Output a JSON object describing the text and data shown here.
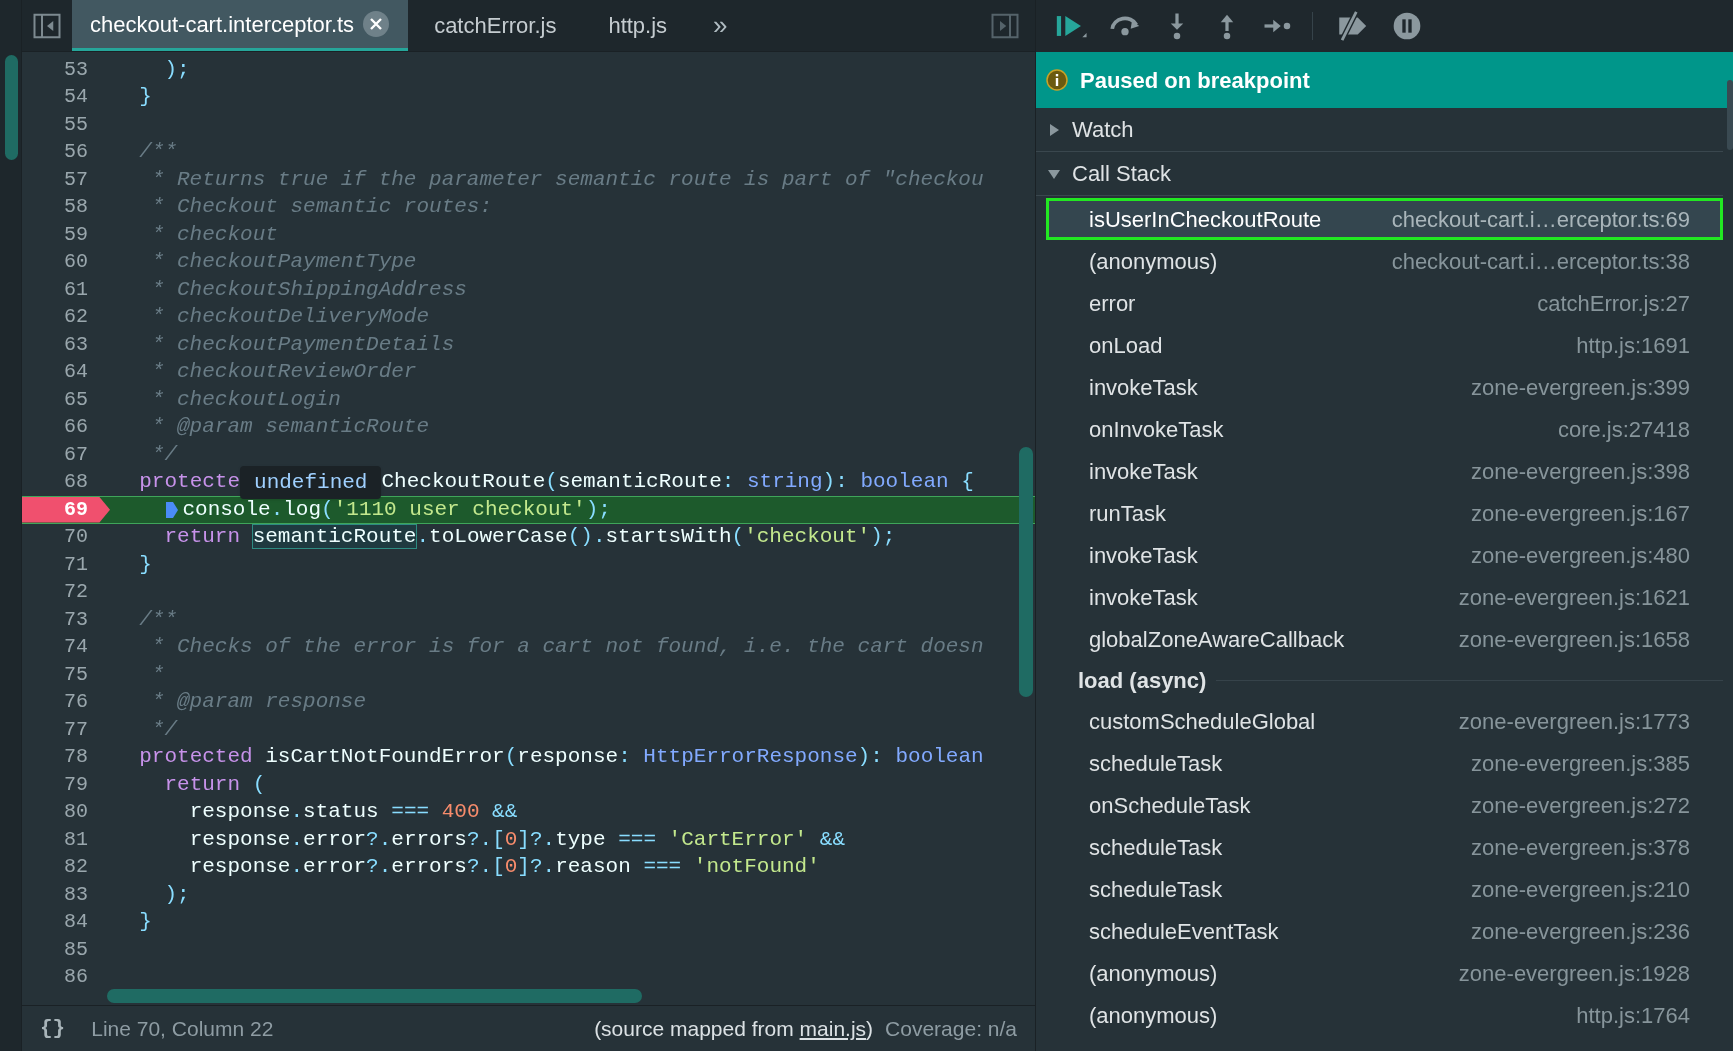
{
  "editor": {
    "tabs": [
      {
        "label": "checkout-cart.interceptor.ts",
        "selected": true,
        "closable": true
      },
      {
        "label": "catchError.js",
        "selected": false,
        "closable": false
      },
      {
        "label": "http.js",
        "selected": false,
        "closable": false
      }
    ],
    "tab_overflow": "»",
    "lines": [
      {
        "number": "53",
        "breakpoint": false,
        "current": false,
        "tokens": [
          {
            "kind": "punct",
            "text": "    );"
          }
        ]
      },
      {
        "number": "54",
        "breakpoint": false,
        "current": false,
        "tokens": [
          {
            "kind": "punct",
            "text": "  }"
          }
        ]
      },
      {
        "number": "55",
        "breakpoint": false,
        "current": false
      },
      {
        "number": "56",
        "breakpoint": false,
        "current": false,
        "tokens": [
          {
            "kind": "comment",
            "text": "  /**"
          }
        ]
      },
      {
        "number": "57",
        "breakpoint": false,
        "current": false,
        "tokens": [
          {
            "kind": "comment",
            "text": "   * Returns true if the parameter semantic route is part of \"checkou"
          }
        ]
      },
      {
        "number": "58",
        "breakpoint": false,
        "current": false,
        "tokens": [
          {
            "kind": "comment",
            "text": "   * Checkout semantic routes:"
          }
        ]
      },
      {
        "number": "59",
        "breakpoint": false,
        "current": false,
        "tokens": [
          {
            "kind": "comment",
            "text": "   * checkout"
          }
        ]
      },
      {
        "number": "60",
        "breakpoint": false,
        "current": false,
        "tokens": [
          {
            "kind": "comment",
            "text": "   * checkoutPaymentType"
          }
        ]
      },
      {
        "number": "61",
        "breakpoint": false,
        "current": false,
        "tokens": [
          {
            "kind": "comment",
            "text": "   * CheckoutShippingAddress"
          }
        ]
      },
      {
        "number": "62",
        "breakpoint": false,
        "current": false,
        "tokens": [
          {
            "kind": "comment",
            "text": "   * checkoutDeliveryMode"
          }
        ]
      },
      {
        "number": "63",
        "breakpoint": false,
        "current": false,
        "tokens": [
          {
            "kind": "comment",
            "text": "   * checkoutPaymentDetails"
          }
        ]
      },
      {
        "number": "64",
        "breakpoint": false,
        "current": false,
        "tokens": [
          {
            "kind": "comment",
            "text": "   * checkoutReviewOrder"
          }
        ]
      },
      {
        "number": "65",
        "breakpoint": false,
        "current": false,
        "tokens": [
          {
            "kind": "comment",
            "text": "   * checkoutLogin"
          }
        ]
      },
      {
        "number": "66",
        "breakpoint": false,
        "current": false,
        "tokens": [
          {
            "kind": "comment",
            "text": "   * @param semanticRoute"
          }
        ]
      },
      {
        "number": "67",
        "breakpoint": false,
        "current": false,
        "tokens": [
          {
            "kind": "comment",
            "text": "   */"
          }
        ]
      },
      {
        "number": "68",
        "breakpoint": false,
        "current": false,
        "tokens": [
          {
            "kind": "keyword",
            "text": "  protecte"
          },
          {
            "kind": "tooltip",
            "text": "undefined"
          },
          {
            "kind": "plain",
            "text": "CheckoutRoute"
          },
          {
            "kind": "punct",
            "text": "("
          },
          {
            "kind": "plain",
            "text": "semanticRoute"
          },
          {
            "kind": "punct",
            "text": ": "
          },
          {
            "kind": "type",
            "text": "string"
          },
          {
            "kind": "punct",
            "text": "): "
          },
          {
            "kind": "type",
            "text": "boolean"
          },
          {
            "kind": "punct",
            "text": " {"
          }
        ]
      },
      {
        "number": "69",
        "breakpoint": true,
        "current": true,
        "tokens": [
          {
            "kind": "plain",
            "text": "    console"
          },
          {
            "kind": "punct",
            "text": "."
          },
          {
            "kind": "plain",
            "text": "log"
          },
          {
            "kind": "punct",
            "text": "("
          },
          {
            "kind": "string",
            "text": "'1110 user checkout'"
          },
          {
            "kind": "punct",
            "text": ");"
          }
        ]
      },
      {
        "number": "70",
        "breakpoint": false,
        "current": false,
        "tokens": [
          {
            "kind": "keyword",
            "text": "    return "
          },
          {
            "kind": "highlight",
            "text": "semanticRoute"
          },
          {
            "kind": "punct",
            "text": "."
          },
          {
            "kind": "plain",
            "text": "toLowerCase"
          },
          {
            "kind": "punct",
            "text": "()."
          },
          {
            "kind": "plain",
            "text": "startsWith"
          },
          {
            "kind": "punct",
            "text": "("
          },
          {
            "kind": "string",
            "text": "'checkout'"
          },
          {
            "kind": "punct",
            "text": ");"
          }
        ]
      },
      {
        "number": "71",
        "breakpoint": false,
        "current": false,
        "tokens": [
          {
            "kind": "punct",
            "text": "  }"
          }
        ]
      },
      {
        "number": "72",
        "breakpoint": false,
        "current": false
      },
      {
        "number": "73",
        "breakpoint": false,
        "current": false,
        "tokens": [
          {
            "kind": "comment",
            "text": "  /**"
          }
        ]
      },
      {
        "number": "74",
        "breakpoint": false,
        "current": false,
        "tokens": [
          {
            "kind": "comment",
            "text": "   * Checks of the error is for a cart not found, i.e. the cart doesn"
          }
        ]
      },
      {
        "number": "75",
        "breakpoint": false,
        "current": false,
        "tokens": [
          {
            "kind": "comment",
            "text": "   *"
          }
        ]
      },
      {
        "number": "76",
        "breakpoint": false,
        "current": false,
        "tokens": [
          {
            "kind": "comment",
            "text": "   * @param response"
          }
        ]
      },
      {
        "number": "77",
        "breakpoint": false,
        "current": false,
        "tokens": [
          {
            "kind": "comment",
            "text": "   */"
          }
        ]
      },
      {
        "number": "78",
        "breakpoint": false,
        "current": false,
        "tokens": [
          {
            "kind": "keyword",
            "text": "  protected "
          },
          {
            "kind": "plain",
            "text": "isCartNotFoundError"
          },
          {
            "kind": "punct",
            "text": "("
          },
          {
            "kind": "plain",
            "text": "response"
          },
          {
            "kind": "punct",
            "text": ": "
          },
          {
            "kind": "type",
            "text": "HttpErrorResponse"
          },
          {
            "kind": "punct",
            "text": "): "
          },
          {
            "kind": "type",
            "text": "boolean"
          }
        ]
      },
      {
        "number": "79",
        "breakpoint": false,
        "current": false,
        "tokens": [
          {
            "kind": "keyword",
            "text": "    return "
          },
          {
            "kind": "punct",
            "text": "("
          }
        ]
      },
      {
        "number": "80",
        "breakpoint": false,
        "current": false,
        "tokens": [
          {
            "kind": "plain",
            "text": "      response"
          },
          {
            "kind": "punct",
            "text": "."
          },
          {
            "kind": "plain",
            "text": "status "
          },
          {
            "kind": "operator",
            "text": "=== "
          },
          {
            "kind": "number",
            "text": "400"
          },
          {
            "kind": "operator",
            "text": " &&"
          }
        ]
      },
      {
        "number": "81",
        "breakpoint": false,
        "current": false,
        "tokens": [
          {
            "kind": "plain",
            "text": "      response"
          },
          {
            "kind": "punct",
            "text": "."
          },
          {
            "kind": "plain",
            "text": "error"
          },
          {
            "kind": "punct",
            "text": "?."
          },
          {
            "kind": "plain",
            "text": "errors"
          },
          {
            "kind": "punct",
            "text": "?.["
          },
          {
            "kind": "number",
            "text": "0"
          },
          {
            "kind": "punct",
            "text": "]?."
          },
          {
            "kind": "plain",
            "text": "type "
          },
          {
            "kind": "operator",
            "text": "=== "
          },
          {
            "kind": "string",
            "text": "'CartError'"
          },
          {
            "kind": "operator",
            "text": " &&"
          }
        ]
      },
      {
        "number": "82",
        "breakpoint": false,
        "current": false,
        "tokens": [
          {
            "kind": "plain",
            "text": "      response"
          },
          {
            "kind": "punct",
            "text": "."
          },
          {
            "kind": "plain",
            "text": "error"
          },
          {
            "kind": "punct",
            "text": "?."
          },
          {
            "kind": "plain",
            "text": "errors"
          },
          {
            "kind": "punct",
            "text": "?.["
          },
          {
            "kind": "number",
            "text": "0"
          },
          {
            "kind": "punct",
            "text": "]?."
          },
          {
            "kind": "plain",
            "text": "reason "
          },
          {
            "kind": "operator",
            "text": "=== "
          },
          {
            "kind": "string",
            "text": "'notFound'"
          }
        ]
      },
      {
        "number": "83",
        "breakpoint": false,
        "current": false,
        "tokens": [
          {
            "kind": "punct",
            "text": "    );"
          }
        ]
      },
      {
        "number": "84",
        "breakpoint": false,
        "current": false,
        "tokens": [
          {
            "kind": "punct",
            "text": "  }"
          }
        ]
      },
      {
        "number": "85",
        "breakpoint": false,
        "current": false
      },
      {
        "number": "86",
        "breakpoint": false,
        "current": false
      }
    ],
    "status_bar": {
      "format_button": "{}",
      "position": "Line 70, Column 22",
      "source_prefix": "(source mapped from ",
      "source_link": "main.js",
      "source_suffix": ")",
      "coverage": "Coverage: n/a"
    }
  },
  "debugger": {
    "banner": "Paused on breakpoint",
    "sections": [
      {
        "title": "Watch",
        "expanded": false
      },
      {
        "title": "Call Stack",
        "expanded": true
      }
    ],
    "frames": [
      {
        "kind": "frame",
        "name": "isUserInCheckoutRoute",
        "location": "checkout-cart.i…erceptor.ts:69",
        "selected": true
      },
      {
        "kind": "frame",
        "name": "(anonymous)",
        "location": "checkout-cart.i…erceptor.ts:38",
        "selected": false
      },
      {
        "kind": "frame",
        "name": "error",
        "location": "catchError.js:27",
        "selected": false
      },
      {
        "kind": "frame",
        "name": "onLoad",
        "location": "http.js:1691",
        "selected": false
      },
      {
        "kind": "frame",
        "name": "invokeTask",
        "location": "zone-evergreen.js:399",
        "selected": false
      },
      {
        "kind": "frame",
        "name": "onInvokeTask",
        "location": "core.js:27418",
        "selected": false
      },
      {
        "kind": "frame",
        "name": "invokeTask",
        "location": "zone-evergreen.js:398",
        "selected": false
      },
      {
        "kind": "frame",
        "name": "runTask",
        "location": "zone-evergreen.js:167",
        "selected": false
      },
      {
        "kind": "frame",
        "name": "invokeTask",
        "location": "zone-evergreen.js:480",
        "selected": false
      },
      {
        "kind": "frame",
        "name": "invokeTask",
        "location": "zone-evergreen.js:1621",
        "selected": false
      },
      {
        "kind": "frame",
        "name": "globalZoneAwareCallback",
        "location": "zone-evergreen.js:1658",
        "selected": false
      },
      {
        "kind": "async",
        "name": "load (async)"
      },
      {
        "kind": "frame",
        "name": "customScheduleGlobal",
        "location": "zone-evergreen.js:1773",
        "selected": false
      },
      {
        "kind": "frame",
        "name": "scheduleTask",
        "location": "zone-evergreen.js:385",
        "selected": false
      },
      {
        "kind": "frame",
        "name": "onScheduleTask",
        "location": "zone-evergreen.js:272",
        "selected": false
      },
      {
        "kind": "frame",
        "name": "scheduleTask",
        "location": "zone-evergreen.js:378",
        "selected": false
      },
      {
        "kind": "frame",
        "name": "scheduleTask",
        "location": "zone-evergreen.js:210",
        "selected": false
      },
      {
        "kind": "frame",
        "name": "scheduleEventTask",
        "location": "zone-evergreen.js:236",
        "selected": false
      },
      {
        "kind": "frame",
        "name": "(anonymous)",
        "location": "zone-evergreen.js:1928",
        "selected": false
      },
      {
        "kind": "frame",
        "name": "(anonymous)",
        "location": "http.js:1764",
        "selected": false
      }
    ]
  }
}
